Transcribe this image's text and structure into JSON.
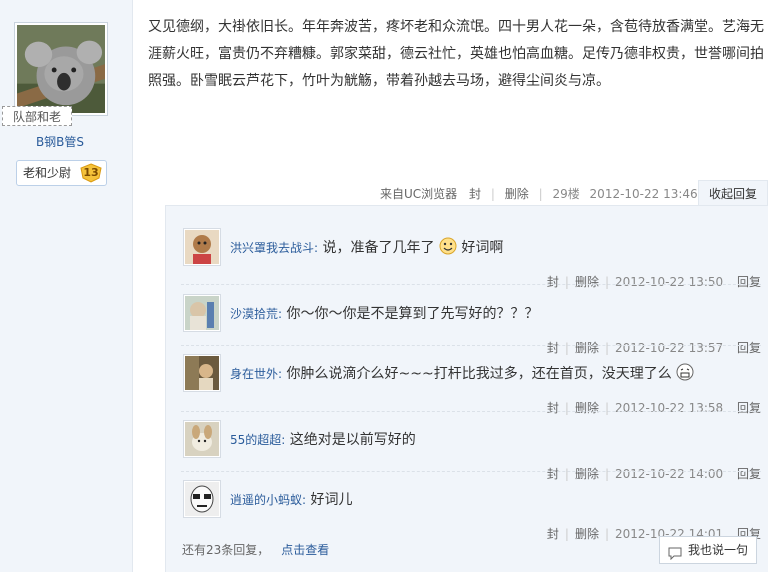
{
  "author": {
    "tag": "队部和老",
    "username": "B钢B管S",
    "rank_label": "老和少尉",
    "rank_level": "13"
  },
  "post": {
    "body": "又见德纲，大褂依旧长。年年奔波苦，疼坏老和众流氓。四十男人花一朵，含苞待放香满堂。艺海无涯薪火旺，富贵仍不弃糟糠。郭家菜甜，德云社忙，英雄也怕高血糖。足传乃德非权贵，世誉哪间拍照强。卧雪眠云芦花下，竹叶为觥觞，带着孙越去马场，避得尘间炎与凉。",
    "source": "来自UC浏览器",
    "block": "封",
    "delete": "删除",
    "floor": "29楼",
    "time": "2012-10-22 13:46",
    "collapse": "收起回复"
  },
  "replies": [
    {
      "user": "洪兴罩我去战斗:",
      "text": "说，准备了几年了",
      "emoji": "smile-face-emoji",
      "text2": "好词啊",
      "block": "封",
      "delete": "删除",
      "time": "2012-10-22 13:50",
      "reply": "回复"
    },
    {
      "user": "沙漠拾荒:",
      "text": "你～你～你是不是算到了先写好的？？？",
      "block": "封",
      "delete": "删除",
      "time": "2012-10-22 13:57",
      "reply": "回复"
    },
    {
      "user": "身在世外:",
      "text": "你肿么说滴介么好~~~打杆比我过多，还在首页，没天理了么",
      "emoji": "grin-face-emoji",
      "block": "封",
      "delete": "删除",
      "time": "2012-10-22 13:58",
      "reply": "回复"
    },
    {
      "user": "55的超超:",
      "text": "这绝对是以前写好的",
      "block": "封",
      "delete": "删除",
      "time": "2012-10-22 14:00",
      "reply": "回复"
    },
    {
      "user": "逍遥的小蚂蚁:",
      "text": "好词儿",
      "block": "封",
      "delete": "删除",
      "time": "2012-10-22 14:01",
      "reply": "回复"
    }
  ],
  "footer": {
    "more": "还有23条回复，",
    "view": "点击查看",
    "say": "我也说一句"
  }
}
